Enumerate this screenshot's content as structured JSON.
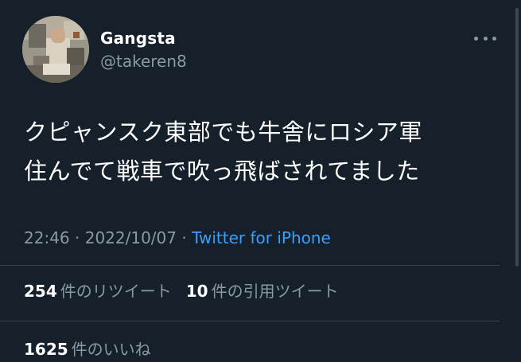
{
  "user": {
    "display_name": "Gangsta",
    "handle": "@takeren8",
    "avatar_icon": "user-avatar-photo"
  },
  "more_icon": "more-horizontal-icon",
  "tweet": {
    "text_lines": [
      "クピャンスク東部でも牛舎にロシア軍",
      "住んでて戦車で吹っ飛ばされてました"
    ],
    "time": "22:46",
    "separator": " · ",
    "date": "2022/10/07",
    "source_separator": " · ",
    "source": "Twitter for iPhone"
  },
  "stats": {
    "retweets": {
      "count": "254",
      "label": "件のリツイート"
    },
    "quotes": {
      "count": "10",
      "label": "件の引用ツイート"
    },
    "likes": {
      "count": "1625",
      "label": "件のいいね"
    }
  },
  "colors": {
    "background": "#15202b",
    "primary_text": "#ffffff",
    "secondary_text": "#8b98a5",
    "link": "#3d9ef5",
    "divider": "#38444d"
  }
}
